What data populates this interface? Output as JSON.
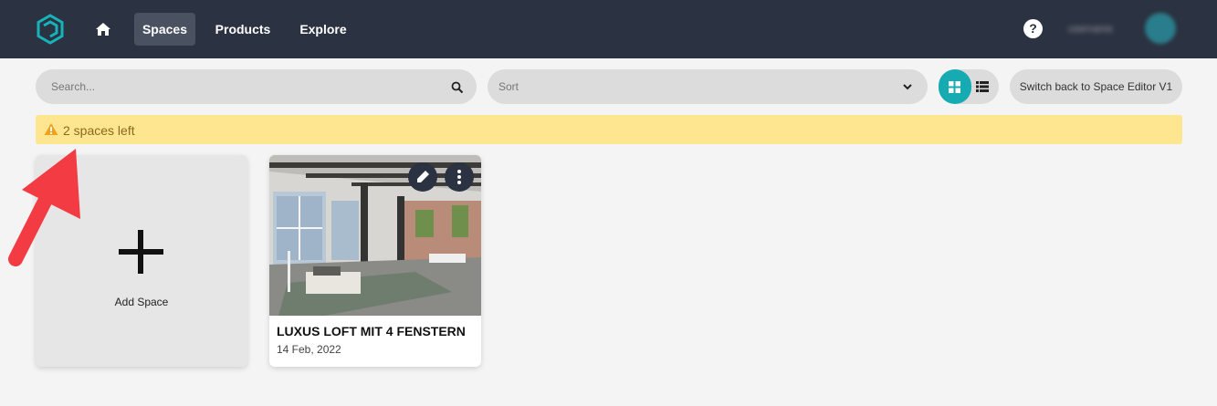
{
  "nav": {
    "items": [
      {
        "label": "Spaces",
        "active": true
      },
      {
        "label": "Products",
        "active": false
      },
      {
        "label": "Explore",
        "active": false
      }
    ],
    "help_label": "?",
    "username": "username"
  },
  "toolbar": {
    "search_placeholder": "Search...",
    "sort_placeholder": "Sort",
    "switch_label": "Switch back to Space Editor V1"
  },
  "banner": {
    "text": "2 spaces left"
  },
  "add_card": {
    "label": "Add Space"
  },
  "spaces": [
    {
      "title": "LUXUS LOFT MIT 4 FENSTERN",
      "date": "14 Feb, 2022"
    }
  ],
  "colors": {
    "nav_bg": "#2b3241",
    "accent": "#16aab3",
    "banner_bg": "#fde68f",
    "arrow": "#f23b43"
  }
}
